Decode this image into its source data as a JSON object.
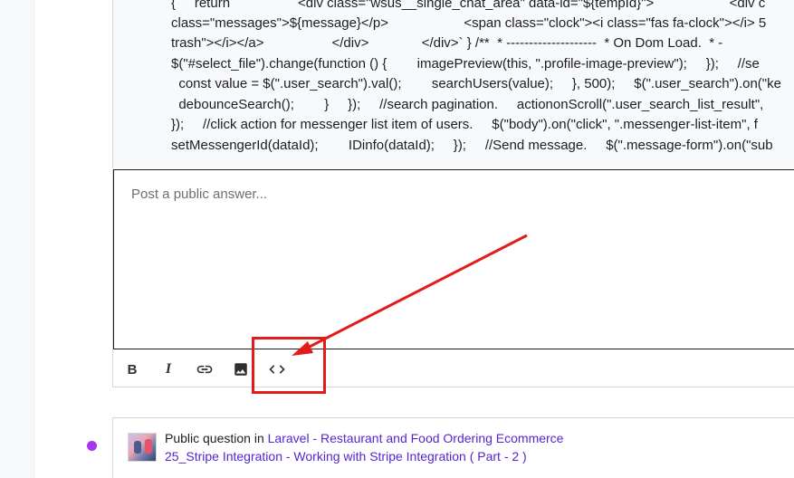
{
  "code_block": {
    "lines": [
      "{     return                  <div class=\"wsus__single_chat_area\" data-id=\"${tempId}\">                    <div c",
      "class=\"messages\">${message}</p>                    <span class=\"clock\"><i class=\"fas fa-clock\"></i> 5",
      "trash\"></i></a>                  </div>              </div>` } /**  * --------------------  * On Dom Load.  * -",
      "$(\"#select_file\").change(function () {        imagePreview(this, \".profile-image-preview\");     });     //se",
      "  const value = $(\".user_search\").val();        searchUsers(value);     }, 500);     $(\".user_search\").on(\"ke",
      "  debounceSearch();        }     });     //search pagination.     actiononScroll(\".user_search_list_result\",",
      "});     //click action for messenger list item of users.     $(\"body\").on(\"click\", \".messenger-list-item\", f",
      "setMessengerId(dataId);        IDinfo(dataId);     });     //Send message.     $(\".message-form\").on(\"sub"
    ]
  },
  "editor": {
    "placeholder": "Post a public answer..."
  },
  "toolbar": {
    "bold_label": "B",
    "italic_label": "I"
  },
  "question": {
    "prefix": "Public question in ",
    "course": "Laravel - Restaurant and Food Ordering Ecommerce",
    "lecture": "25_Stripe Integration - Working with Stripe Integration ( Part - 2 )"
  },
  "colors": {
    "accent": "#5624d0",
    "unread_dot": "#a435f0",
    "annotation": "#e21b1b"
  }
}
